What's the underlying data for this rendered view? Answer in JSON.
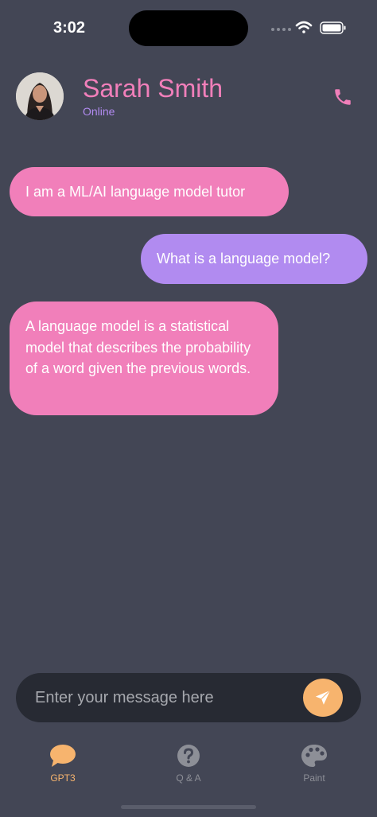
{
  "status_bar": {
    "time": "3:02",
    "icons": [
      "signal-icon",
      "wifi-icon",
      "battery-icon"
    ]
  },
  "contact": {
    "name": "Sarah Smith",
    "status": "Online",
    "avatar_icon": "person-photo",
    "call_icon": "phone-icon"
  },
  "messages": [
    {
      "sender": "bot",
      "text": "I am a ML/AI language model tutor"
    },
    {
      "sender": "user",
      "text": "What is a language model?"
    },
    {
      "sender": "bot",
      "text": "A language model is a statistical model that describes the probability of a word given the previous words."
    }
  ],
  "composer": {
    "placeholder": "Enter your message here",
    "value": "",
    "send_icon": "send-icon"
  },
  "tabs": [
    {
      "label": "GPT3",
      "icon": "chat-bubble-icon",
      "active": true
    },
    {
      "label": "Q & A",
      "icon": "question-icon",
      "active": false
    },
    {
      "label": "Paint",
      "icon": "palette-icon",
      "active": false
    }
  ],
  "colors": {
    "background": "#434655",
    "bot_bubble": "#f17fba",
    "user_bubble": "#b18bf0",
    "accent": "#f7b46e",
    "composer": "#272a33"
  }
}
